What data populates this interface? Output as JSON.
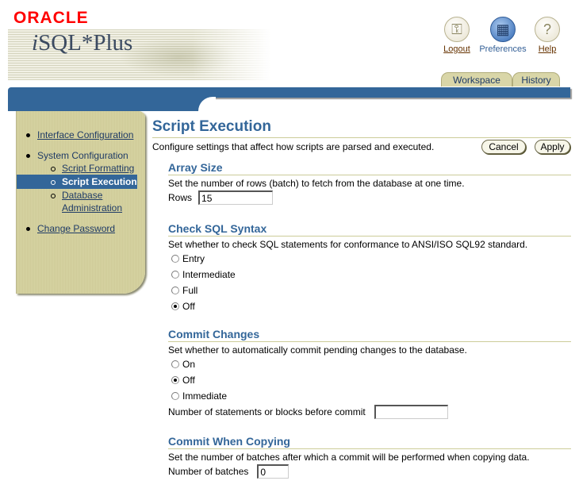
{
  "header": {
    "oracle_logo": "ORACLE",
    "app_title_prefix": "i",
    "app_title_rest": "SQL*Plus",
    "global_links": [
      {
        "label": "Logout",
        "icon": "key-icon",
        "glyph": "⚿"
      },
      {
        "label": "Preferences",
        "icon": "preferences-icon",
        "glyph": "▦"
      },
      {
        "label": "Help",
        "icon": "help-icon",
        "glyph": "?"
      }
    ],
    "tabs": [
      {
        "label": "Workspace"
      },
      {
        "label": "History"
      }
    ]
  },
  "side_nav": {
    "items": [
      {
        "label": "Interface Configuration"
      },
      {
        "label": "System Configuration",
        "children": [
          {
            "label": "Script Formatting"
          },
          {
            "label": "Script Execution",
            "selected": true
          },
          {
            "label": "Database Administration"
          }
        ]
      },
      {
        "label": "Change Password"
      }
    ]
  },
  "main": {
    "title": "Script Execution",
    "description": "Configure settings that affect how scripts are parsed and executed.",
    "cancel_label": "Cancel",
    "apply_label": "Apply",
    "sections": {
      "array_size": {
        "title": "Array Size",
        "description": "Set the number of rows (batch) to fetch from the database at one time.",
        "field_label": "Rows",
        "field_value": "15"
      },
      "check_sql_syntax": {
        "title": "Check SQL Syntax",
        "description": "Set whether to check SQL statements for conformance to ANSI/ISO SQL92 standard.",
        "options": [
          "Entry",
          "Intermediate",
          "Full",
          "Off"
        ],
        "selected": "Off"
      },
      "commit_changes": {
        "title": "Commit Changes",
        "description": "Set whether to automatically commit pending changes to the database.",
        "options": [
          "On",
          "Off",
          "Immediate"
        ],
        "selected": "Off",
        "field_label": "Number of statements or blocks before commit",
        "field_value": ""
      },
      "commit_when_copying": {
        "title": "Commit When Copying",
        "description": "Set the number of batches after which a commit will be performed when copying data.",
        "field_label": "Number of batches",
        "field_value": "0"
      }
    }
  }
}
